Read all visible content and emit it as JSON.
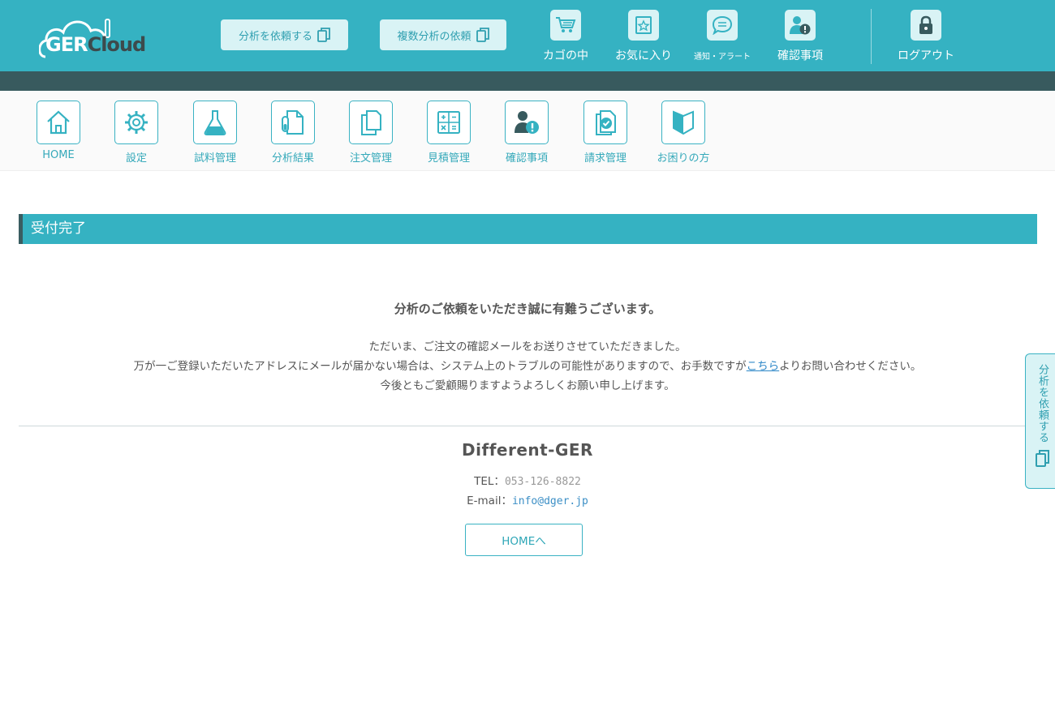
{
  "header": {
    "logo": {
      "part1": "GER",
      "part2": "Cloud"
    },
    "request_button": "分析を依頼する",
    "multi_request_button": "複数分析の依頼",
    "nav": [
      {
        "label": "カゴの中",
        "icon": "cart-icon"
      },
      {
        "label": "お気に入り",
        "icon": "favorite-star-icon"
      },
      {
        "label": "通知・アラート",
        "icon": "chat-bubble-icon"
      },
      {
        "label": "確認事項",
        "icon": "user-alert-icon"
      }
    ],
    "logout": {
      "label": "ログアウト",
      "icon": "lock-icon"
    }
  },
  "main_nav": [
    {
      "label": "HOME",
      "icon": "home-icon"
    },
    {
      "label": "設定",
      "icon": "gear-icon"
    },
    {
      "label": "試料管理",
      "icon": "flask-icon"
    },
    {
      "label": "分析結果",
      "icon": "test-tube-document-icon"
    },
    {
      "label": "注文管理",
      "icon": "documents-icon"
    },
    {
      "label": "見積管理",
      "icon": "calculator-icon"
    },
    {
      "label": "確認事項",
      "icon": "user-alert-icon"
    },
    {
      "label": "請求管理",
      "icon": "document-check-icon"
    },
    {
      "label": "お困りの方",
      "icon": "beginner-mark-icon"
    }
  ],
  "content": {
    "section_title": "受付完了",
    "thanks": "分析のご依頼をいただき誠に有難うございます。",
    "line1": "ただいま、ご注文の確認メールをお送りさせていただきました。",
    "line2_before": "万が一ご登録いただいたアドレスにメールが届かない場合は、システム上のトラブルの可能性がありますので、お手数ですが",
    "line2_link": "こちら",
    "line2_after": "よりお問い合わせください。",
    "line3": "今後ともご愛顧賜りますようよろしくお願い申し上げます。"
  },
  "footer": {
    "company": "Different-GER",
    "tel_label": "TEL：",
    "tel": "053-126-8822",
    "email_label": "E-mail：",
    "email": "info@dger.jp",
    "home_button": "HOMEへ"
  },
  "side_tab": {
    "label": "分析を依頼する",
    "icon": "copy-icon"
  },
  "colors": {
    "primary": "#35b2c2",
    "dark_bar": "#385a5e",
    "light": "#d9f3f5",
    "link": "#2f88c8"
  }
}
